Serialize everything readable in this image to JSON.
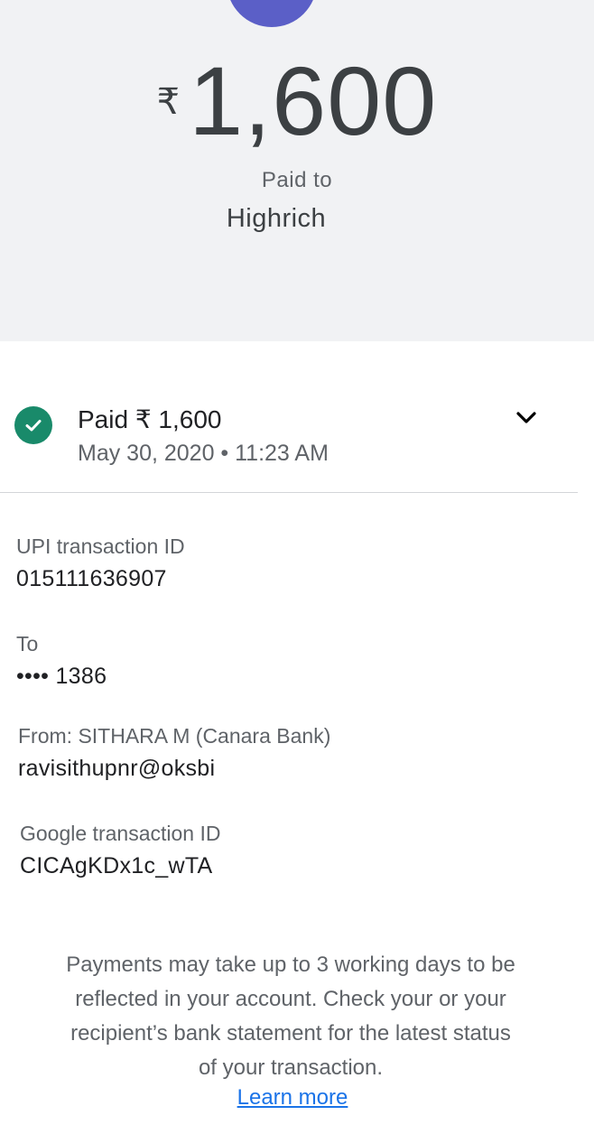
{
  "header": {
    "currency_symbol": "₹",
    "amount": "1,600",
    "paid_to_label": "Paid to",
    "payee_name": "Highrich"
  },
  "status": {
    "title": "Paid ₹ 1,600",
    "timestamp": "May 30, 2020 • 11:23 AM",
    "icon": "check-circle-icon",
    "expand_icon": "chevron-down-icon"
  },
  "details": {
    "upi_label": "UPI transaction ID",
    "upi_value": "015111636907",
    "to_label": "To",
    "to_value": "•••• 1386",
    "from_label": "From: SITHARA M (Canara Bank)",
    "from_value": "ravisithupnr@oksbi",
    "google_label": "Google transaction ID",
    "google_value": "CICAgKDx1c_wTA"
  },
  "footer": {
    "note": "Payments may take up to 3 working days to be reflected in your account. Check your or your recipient’s bank statement for the latest status of your transaction.",
    "learn_more": "Learn more"
  },
  "colors": {
    "header_bg": "#f1f2f4",
    "avatar": "#5b5fc7",
    "success": "#198a6a",
    "link": "#1a73e8"
  }
}
